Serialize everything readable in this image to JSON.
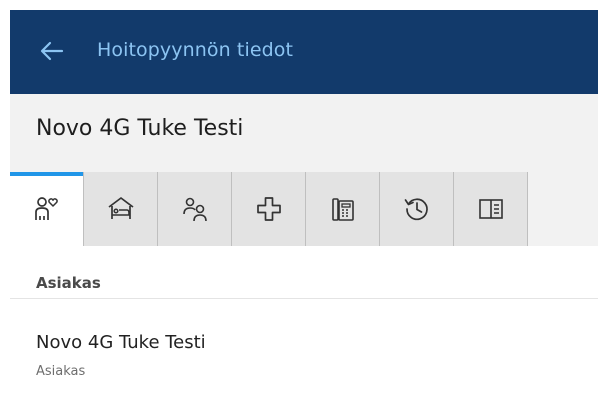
{
  "appbar": {
    "title": "Hoitopyynnön tiedot",
    "back_icon": "arrow-left-icon"
  },
  "customer": {
    "name": "Novo 4G Tuke Testi"
  },
  "tabs": [
    {
      "icon": "person-heart-icon",
      "active": true
    },
    {
      "icon": "bed-icon",
      "active": false
    },
    {
      "icon": "people-icon",
      "active": false
    },
    {
      "icon": "medical-cross-icon",
      "active": false
    },
    {
      "icon": "phone-device-icon",
      "active": false
    },
    {
      "icon": "history-icon",
      "active": false
    },
    {
      "icon": "panel-list-icon",
      "active": false
    }
  ],
  "section": {
    "label": "Asiakas"
  },
  "list": [
    {
      "name": "Novo 4G Tuke Testi",
      "role": "Asiakas"
    }
  ],
  "colors": {
    "appbar": "#123a6b",
    "title": "#8cc4f2",
    "accent": "#2196e8"
  }
}
